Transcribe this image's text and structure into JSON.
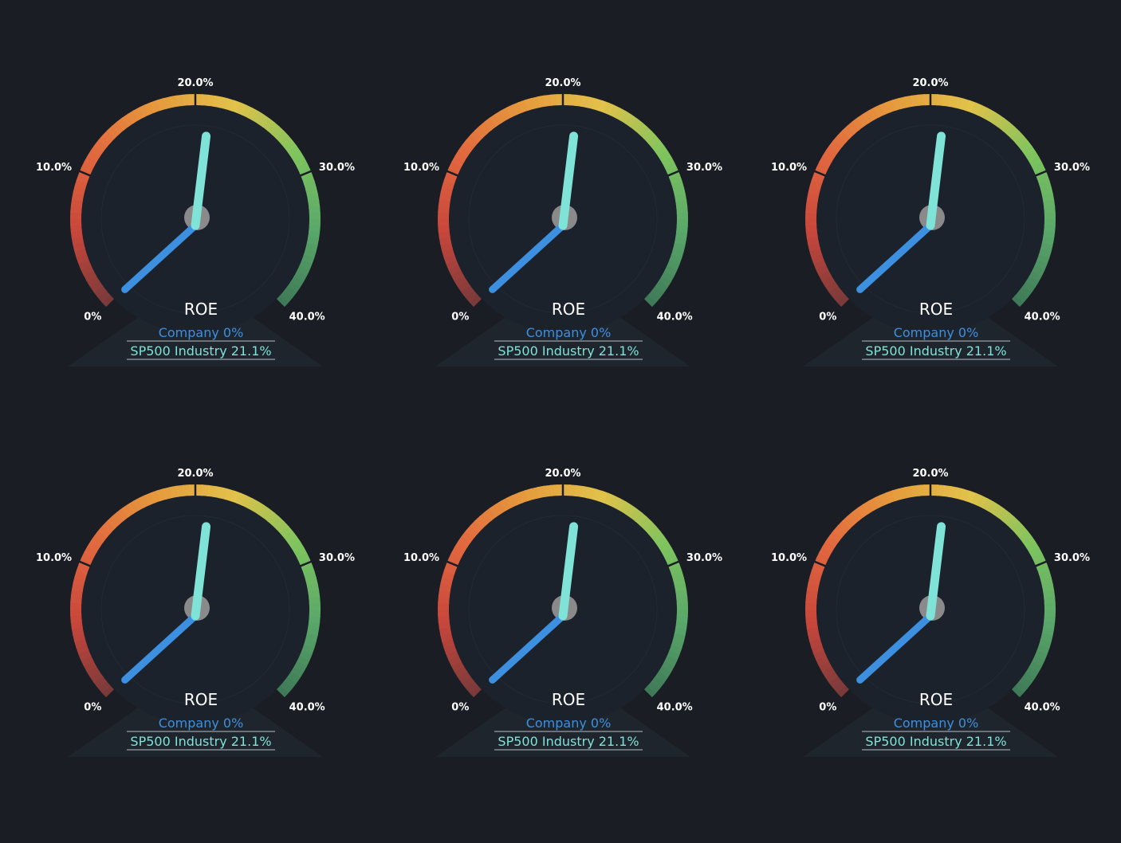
{
  "theme": {
    "background": "#1a1d24",
    "dial_face": "#1b222b",
    "pedestal": "#1f252d",
    "hub": "#8a8a8a",
    "company_color": "#3d8fe0",
    "industry_color": "#7fe3d8",
    "arc_gradient": [
      "#7a3a3a",
      "#c9473b",
      "#e2683f",
      "#e59a3c",
      "#e2c24a",
      "#7ec45e",
      "#5aa86a",
      "#3f7a58"
    ]
  },
  "chart_data": [
    {
      "type": "gauge",
      "title": "ROE",
      "min": 0,
      "max": 40,
      "ticks": [
        0,
        10,
        20,
        30,
        40
      ],
      "tick_labels": [
        "0%",
        "10.0%",
        "20.0%",
        "30.0%",
        "40.0%"
      ],
      "series": [
        {
          "name": "Company",
          "value": 0,
          "label": "Company 0%"
        },
        {
          "name": "SP500 Industry",
          "value": 21.1,
          "label": "SP500 Industry 21.1%"
        }
      ]
    },
    {
      "type": "gauge",
      "title": "ROE",
      "min": 0,
      "max": 40,
      "ticks": [
        0,
        10,
        20,
        30,
        40
      ],
      "tick_labels": [
        "0%",
        "10.0%",
        "20.0%",
        "30.0%",
        "40.0%"
      ],
      "series": [
        {
          "name": "Company",
          "value": 0,
          "label": "Company 0%"
        },
        {
          "name": "SP500 Industry",
          "value": 21.1,
          "label": "SP500 Industry 21.1%"
        }
      ]
    },
    {
      "type": "gauge",
      "title": "ROE",
      "min": 0,
      "max": 40,
      "ticks": [
        0,
        10,
        20,
        30,
        40
      ],
      "tick_labels": [
        "0%",
        "10.0%",
        "20.0%",
        "30.0%",
        "40.0%"
      ],
      "series": [
        {
          "name": "Company",
          "value": 0,
          "label": "Company 0%"
        },
        {
          "name": "SP500 Industry",
          "value": 21.1,
          "label": "SP500 Industry 21.1%"
        }
      ]
    },
    {
      "type": "gauge",
      "title": "ROE",
      "min": 0,
      "max": 40,
      "ticks": [
        0,
        10,
        20,
        30,
        40
      ],
      "tick_labels": [
        "0%",
        "10.0%",
        "20.0%",
        "30.0%",
        "40.0%"
      ],
      "series": [
        {
          "name": "Company",
          "value": 0,
          "label": "Company 0%"
        },
        {
          "name": "SP500 Industry",
          "value": 21.1,
          "label": "SP500 Industry 21.1%"
        }
      ]
    },
    {
      "type": "gauge",
      "title": "ROE",
      "min": 0,
      "max": 40,
      "ticks": [
        0,
        10,
        20,
        30,
        40
      ],
      "tick_labels": [
        "0%",
        "10.0%",
        "20.0%",
        "30.0%",
        "40.0%"
      ],
      "series": [
        {
          "name": "Company",
          "value": 0,
          "label": "Company 0%"
        },
        {
          "name": "SP500 Industry",
          "value": 21.1,
          "label": "SP500 Industry 21.1%"
        }
      ]
    },
    {
      "type": "gauge",
      "title": "ROE",
      "min": 0,
      "max": 40,
      "ticks": [
        0,
        10,
        20,
        30,
        40
      ],
      "tick_labels": [
        "0%",
        "10.0%",
        "20.0%",
        "30.0%",
        "40.0%"
      ],
      "series": [
        {
          "name": "Company",
          "value": 0,
          "label": "Company 0%"
        },
        {
          "name": "SP500 Industry",
          "value": 21.1,
          "label": "SP500 Industry 21.1%"
        }
      ]
    }
  ]
}
